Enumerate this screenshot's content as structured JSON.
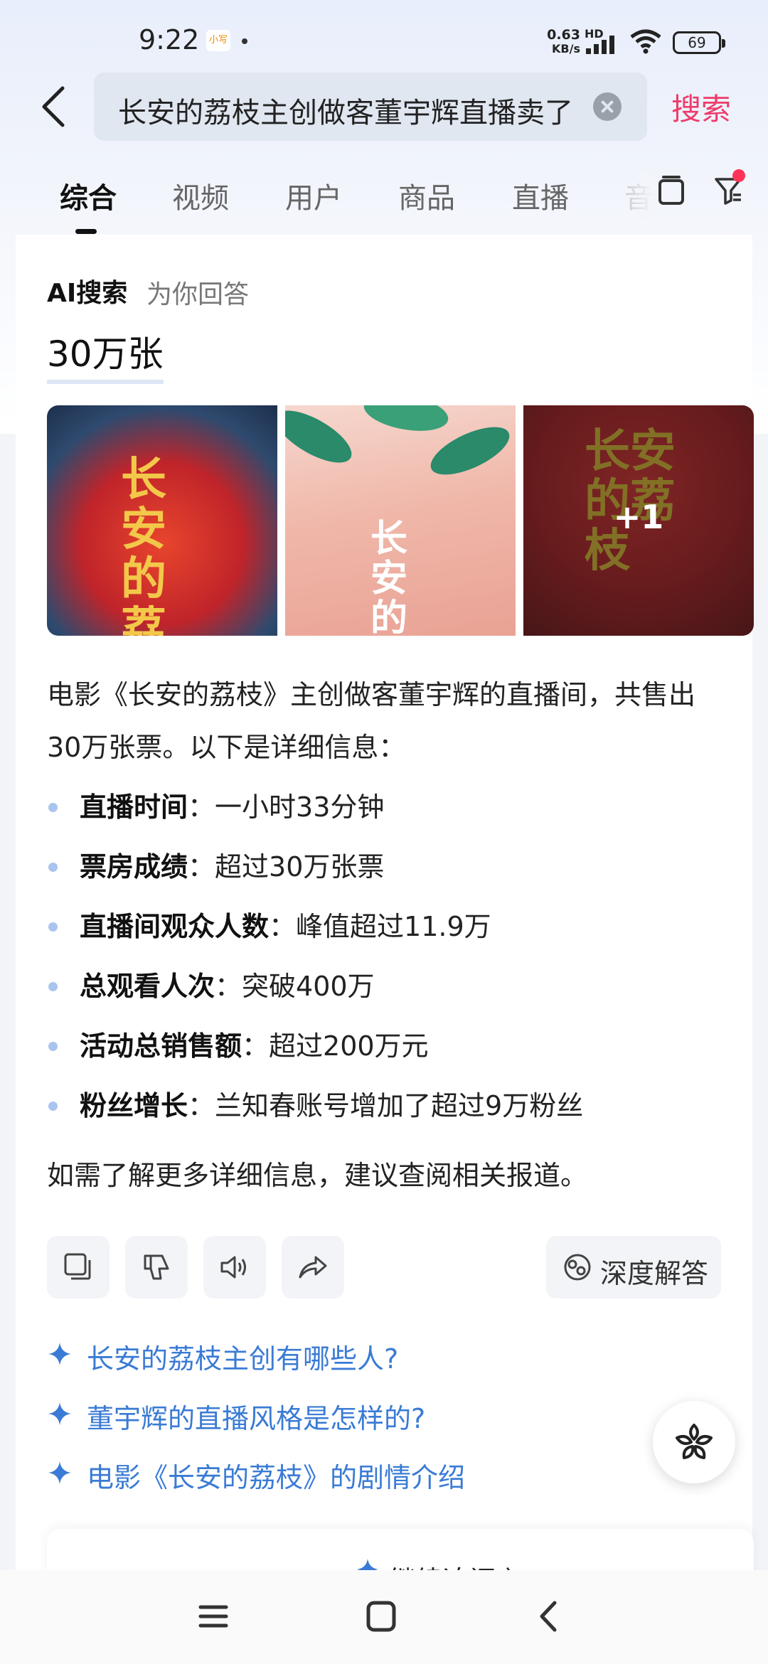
{
  "status_bar": {
    "time": "9:22",
    "app_badge": "小写",
    "net_speed_value": "0.63",
    "net_speed_unit": "KB/s",
    "net_type": "HD",
    "battery": "69"
  },
  "search": {
    "query": "长安的荔枝主创做客董宇辉直播卖了",
    "submit_label": "搜索"
  },
  "tabs": [
    {
      "label": "综合",
      "active": true
    },
    {
      "label": "视频",
      "active": false
    },
    {
      "label": "用户",
      "active": false
    },
    {
      "label": "商品",
      "active": false
    },
    {
      "label": "直播",
      "active": false
    },
    {
      "label": "音",
      "active": false
    }
  ],
  "ai": {
    "title": "AI搜索",
    "subtitle": "为你回答",
    "headline": "30万张"
  },
  "images": {
    "img1_title": "长安的荔枝",
    "img2_title": "长安的荔枝",
    "img3_title": "长安的荔枝",
    "more_count": "+1"
  },
  "answer": {
    "intro": "电影《长安的荔枝》主创做客董宇辉的直播间，共售出30万张票。以下是详细信息：",
    "items": [
      {
        "key": "直播时间",
        "value": "：一小时33分钟"
      },
      {
        "key": "票房成绩",
        "value": "：超过30万张票"
      },
      {
        "key": "直播间观众人数",
        "value": "：峰值超过11.9万"
      },
      {
        "key": "总观看人次",
        "value": "：突破400万"
      },
      {
        "key": "活动总销售额",
        "value": "：超过200万元"
      },
      {
        "key": "粉丝增长",
        "value": "：兰知春账号增加了超过9万粉丝"
      }
    ],
    "outro": "如需了解更多详细信息，建议查阅相关报道。"
  },
  "actions": {
    "copy_icon": "copy-icon",
    "dislike_icon": "thumbs-down-icon",
    "speak_icon": "speaker-icon",
    "share_icon": "share-icon",
    "deep_label": "深度解答"
  },
  "suggestions": [
    "长安的荔枝主创有哪些人?",
    "董宇辉的直播风格是怎样的?",
    "电影《长安的荔枝》的剧情介绍"
  ],
  "continue_label": "继续追问 〉",
  "colors": {
    "accent_pink": "#ee3b6a",
    "suggest_blue": "#3a7bd5",
    "bullet_blue": "#a9c4ee"
  }
}
